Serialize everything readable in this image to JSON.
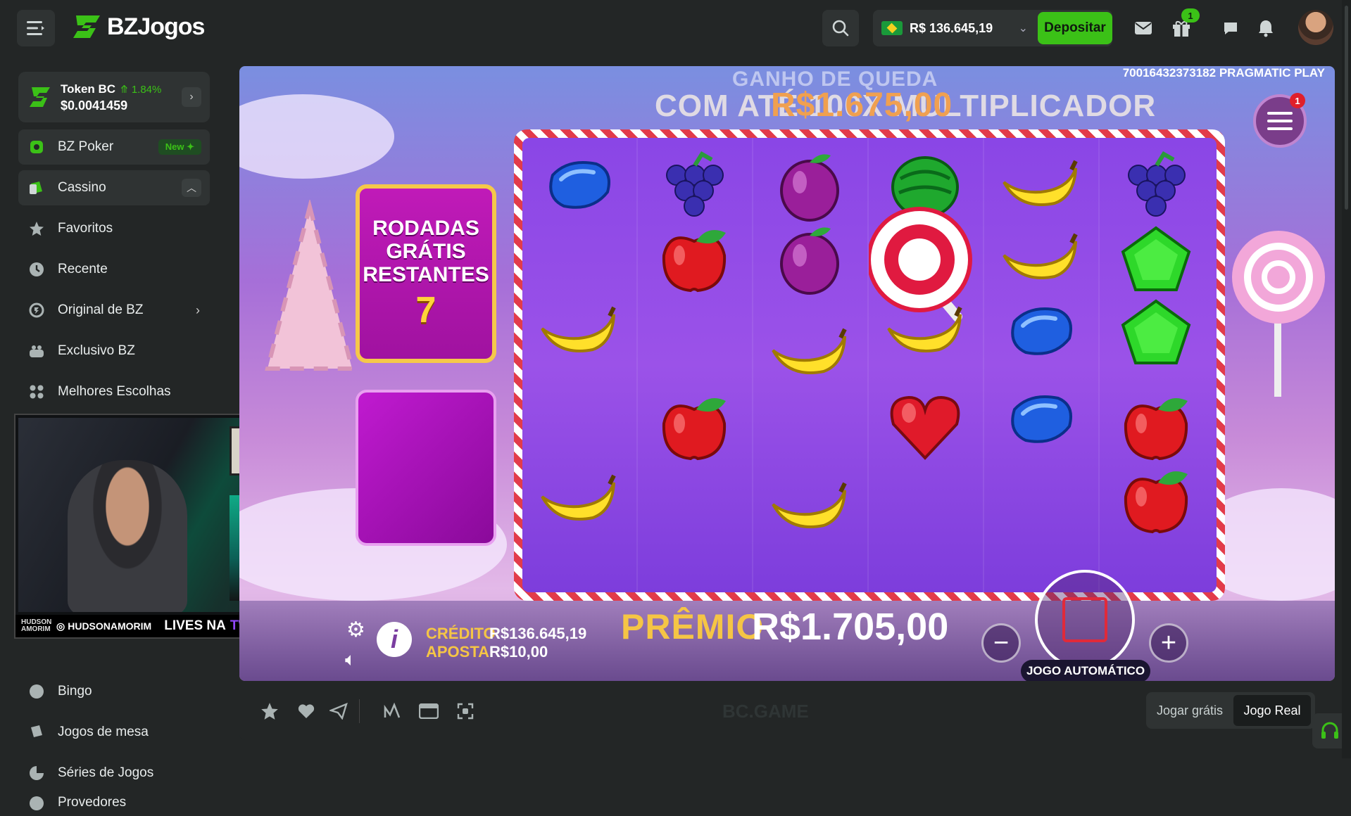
{
  "header": {
    "brand": "BZJogos",
    "wallet_amount": "R$ 136.645,19",
    "deposit_label": "Depositar",
    "gift_badge": "1"
  },
  "token": {
    "name": "Token BC",
    "change": "1.84%",
    "price": "$0.0041459"
  },
  "sidebar": {
    "items": [
      {
        "label": "BZ Poker",
        "badge": "New"
      },
      {
        "label": "Cassino"
      },
      {
        "label": "Favoritos"
      },
      {
        "label": "Recente"
      },
      {
        "label": "Original de BZ"
      },
      {
        "label": "Exclusivo BZ"
      },
      {
        "label": "Melhores Escolhas"
      },
      {
        "label": "Bingo"
      },
      {
        "label": "Jogos de mesa"
      },
      {
        "label": "Séries de Jogos"
      },
      {
        "label": "Provedores"
      }
    ]
  },
  "webcam": {
    "handle": "HUDSONAMORIM",
    "cta": "LIVES NA",
    "platform": "TWITCH"
  },
  "game": {
    "provider_id": "70016432373182",
    "provider": "PRAGMATIC PLAY",
    "banner_top": "GANHO DE QUEDA",
    "banner_main": "COM ATÉ 100X MULTIPLICADOR",
    "banner_amount": "R$1.675,00",
    "freespins_label": "RODADAS GRÁTIS RESTANTES",
    "freespins_count": "7",
    "menu_badge": "1",
    "credit_label": "CRÉDITO",
    "credit_value": "R$136.645,19",
    "bet_label": "APOSTA",
    "bet_value": "R$10,00",
    "prize_label": "PRÊMIO",
    "prize_value": "R$1.705,00",
    "autoplay_label": "JOGO AUTOMÁTICO",
    "grid": [
      [
        "blue-candy",
        "grapes",
        "plum",
        "watermelon",
        "banana",
        "grapes"
      ],
      [
        "apple",
        "plum",
        "lollipop",
        "banana",
        "green-candy"
      ],
      [
        "banana",
        "banana",
        "banana",
        "blue-candy",
        "green-candy"
      ],
      [
        "apple",
        "heart",
        "blue-candy",
        "apple"
      ],
      [
        "banana",
        "banana",
        "apple"
      ]
    ]
  },
  "footer": {
    "watermark": "BC.GAME",
    "mode_free": "Jogar grátis",
    "mode_real": "Jogo Real"
  },
  "colors": {
    "accent_green": "#3bc117",
    "bg": "#232626",
    "panel": "#2f3333"
  }
}
